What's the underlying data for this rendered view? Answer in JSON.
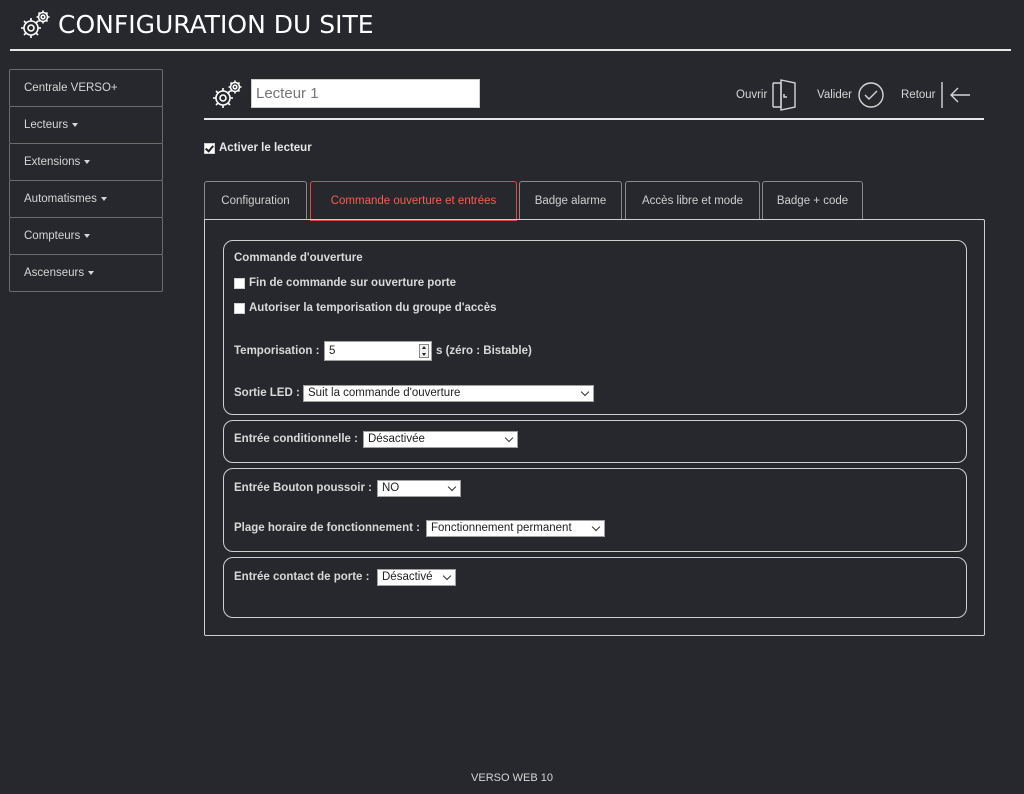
{
  "header": {
    "title": "CONFIGURATION DU SITE",
    "icon": "gears-icon"
  },
  "sidebar": {
    "items": [
      {
        "label": "Centrale VERSO+",
        "dropdown": false
      },
      {
        "label": "Lecteurs",
        "dropdown": true
      },
      {
        "label": "Extensions",
        "dropdown": true
      },
      {
        "label": "Automatismes",
        "dropdown": true
      },
      {
        "label": "Compteurs",
        "dropdown": true
      },
      {
        "label": "Ascenseurs",
        "dropdown": true
      }
    ]
  },
  "toolbar": {
    "name_placeholder": "Lecteur 1",
    "open_label": "Ouvrir",
    "validate_label": "Valider",
    "back_label": "Retour"
  },
  "activate": {
    "label": "Activer le lecteur",
    "checked": true
  },
  "tabs": [
    {
      "label": "Configuration",
      "active": false
    },
    {
      "label": "Commande ouverture et entrées",
      "active": true
    },
    {
      "label": "Badge alarme",
      "active": false
    },
    {
      "label": "Accès libre et mode",
      "active": false
    },
    {
      "label": "Badge + code",
      "active": false
    }
  ],
  "opening": {
    "title": "Commande d'ouverture",
    "end_on_door_open": {
      "label": "Fin de commande sur ouverture porte",
      "checked": false
    },
    "group_timer": {
      "label": "Autoriser la temporisation du groupe d'accès",
      "checked": false
    },
    "timer_label": "Temporisation :",
    "timer_value": "5",
    "timer_suffix": "s (zéro : Bistable)",
    "led_label": "Sortie LED :",
    "led_value": "Suit la commande d'ouverture"
  },
  "conditional": {
    "label": "Entrée conditionnelle :",
    "value": "Désactivée"
  },
  "pushbutton": {
    "label": "Entrée Bouton poussoir :",
    "value": "NO",
    "schedule_label": "Plage horaire de fonctionnement :",
    "schedule_value": "Fonctionnement permanent"
  },
  "door_contact": {
    "label": "Entrée contact de porte :",
    "value": "Désactivé"
  },
  "footer": {
    "text": "VERSO WEB 10"
  },
  "colors": {
    "background": "#27282d",
    "accent": "#ff5a4a",
    "border": "#cfcfcf"
  }
}
